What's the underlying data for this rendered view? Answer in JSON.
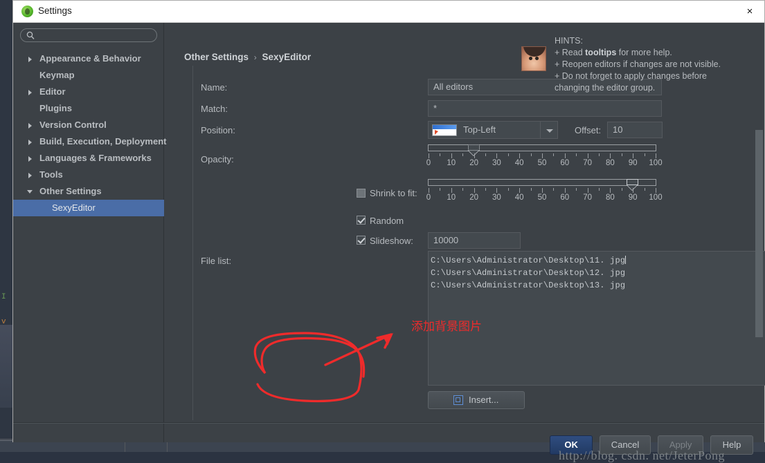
{
  "window": {
    "title": "Settings",
    "app_icon": "android-studio-icon",
    "close_label": "×"
  },
  "sidebar": {
    "search": {
      "value": "",
      "placeholder": "",
      "icon": "search-icon"
    },
    "items": [
      {
        "label": "Appearance & Behavior",
        "arrow": "collapsed",
        "child": false,
        "selected": false
      },
      {
        "label": "Keymap",
        "arrow": "none",
        "child": false,
        "selected": false
      },
      {
        "label": "Editor",
        "arrow": "collapsed",
        "child": false,
        "selected": false
      },
      {
        "label": "Plugins",
        "arrow": "none",
        "child": false,
        "selected": false
      },
      {
        "label": "Version Control",
        "arrow": "collapsed",
        "child": false,
        "selected": false
      },
      {
        "label": "Build, Execution, Deployment",
        "arrow": "collapsed",
        "child": false,
        "selected": false
      },
      {
        "label": "Languages & Frameworks",
        "arrow": "collapsed",
        "child": false,
        "selected": false
      },
      {
        "label": "Tools",
        "arrow": "collapsed",
        "child": false,
        "selected": false
      },
      {
        "label": "Other Settings",
        "arrow": "expanded",
        "child": false,
        "selected": false
      },
      {
        "label": "SexyEditor",
        "arrow": "none",
        "child": true,
        "selected": true
      }
    ]
  },
  "breadcrumb": {
    "parent": "Other Settings",
    "separator": "›",
    "current": "SexyEditor"
  },
  "form": {
    "clipped_row": "",
    "name": {
      "label": "Name:",
      "value": "All editors"
    },
    "match": {
      "label": "Match:",
      "value": "*"
    },
    "position": {
      "label": "Position:",
      "value": "Top-Left",
      "icon": "position-preview-icon"
    },
    "offset": {
      "label": "Offset:",
      "value": "10"
    },
    "opacity": {
      "label": "Opacity:",
      "value": 20,
      "min": 0,
      "max": 100,
      "ticks": [
        "0",
        "10",
        "20",
        "30",
        "40",
        "50",
        "60",
        "70",
        "80",
        "90",
        "100"
      ]
    },
    "shrink": {
      "label": "Shrink to fit:",
      "checked": false,
      "value": 90,
      "min": 0,
      "max": 100,
      "ticks": [
        "0",
        "10",
        "20",
        "30",
        "40",
        "50",
        "60",
        "70",
        "80",
        "90",
        "100"
      ]
    },
    "random": {
      "label": "Random",
      "checked": true
    },
    "slideshow": {
      "label": "Slideshow:",
      "checked": true,
      "value": "10000"
    },
    "file_list": {
      "label": "File list:",
      "lines": [
        "C:\\Users\\Administrator\\Desktop\\11. jpg",
        "C:\\Users\\Administrator\\Desktop\\12. jpg",
        "C:\\Users\\Administrator\\Desktop\\13. jpg"
      ]
    },
    "insert_button": {
      "label": "Insert...",
      "icon": "insert-image-icon"
    }
  },
  "hints": {
    "title": "HINTS:",
    "avatar": "girl-avatar-icon",
    "lines": [
      {
        "prefix": "+ Read ",
        "bold": "tooltips",
        "suffix": " for more help."
      },
      {
        "prefix": "+ Reopen editors if changes are not visible.",
        "bold": "",
        "suffix": ""
      },
      {
        "prefix": "+ Do not forget to apply changes before",
        "bold": "",
        "suffix": ""
      },
      {
        "prefix": "changing the editor group.",
        "bold": "",
        "suffix": ""
      }
    ]
  },
  "footer": {
    "buttons": [
      {
        "label": "OK",
        "style": "primary"
      },
      {
        "label": "Cancel",
        "style": "normal"
      },
      {
        "label": "Apply",
        "style": "disabled"
      },
      {
        "label": "Help",
        "style": "normal"
      }
    ],
    "watermark": "http://blog. csdn. net/JeterPong"
  },
  "annotation": {
    "text": "添加背景图片",
    "color": "#ef2b2b",
    "shapes": "circle-around-insert-button-with-arrow"
  },
  "colors": {
    "dialog_bg": "#3c4146",
    "titlebar_bg": "#ffffff",
    "selection_blue": "#4a6da7",
    "field_bg": "#43494e",
    "text": "#b7bbbf",
    "annotation_red": "#ef2b2b",
    "ok_button": "#2f4d80"
  }
}
